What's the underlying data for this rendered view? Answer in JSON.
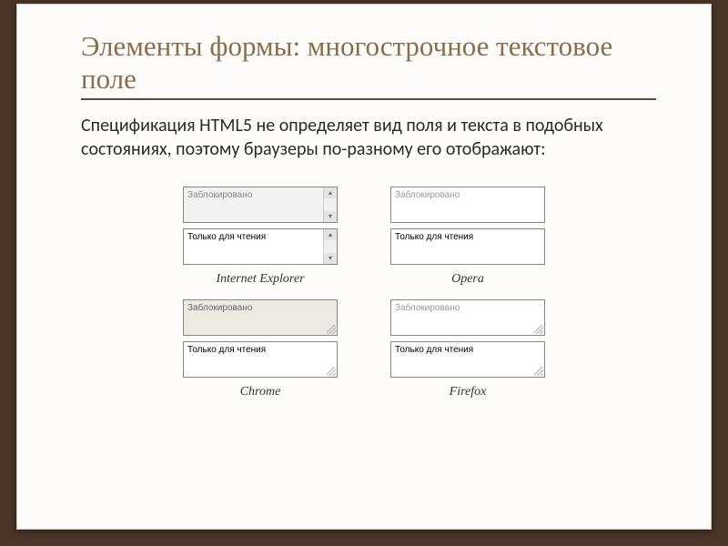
{
  "title": "Элементы формы: многострочное текстовое поле",
  "body": "Спецификация HTML5 не определяет вид поля и текста в подобных состояниях, поэтому браузеры по-разному его отображают:",
  "fields": {
    "disabled": "Заблокировано",
    "readonly": "Только для чтения"
  },
  "browsers": {
    "ie": "Internet Explorer",
    "opera": "Opera",
    "chrome": "Chrome",
    "firefox": "Firefox"
  }
}
